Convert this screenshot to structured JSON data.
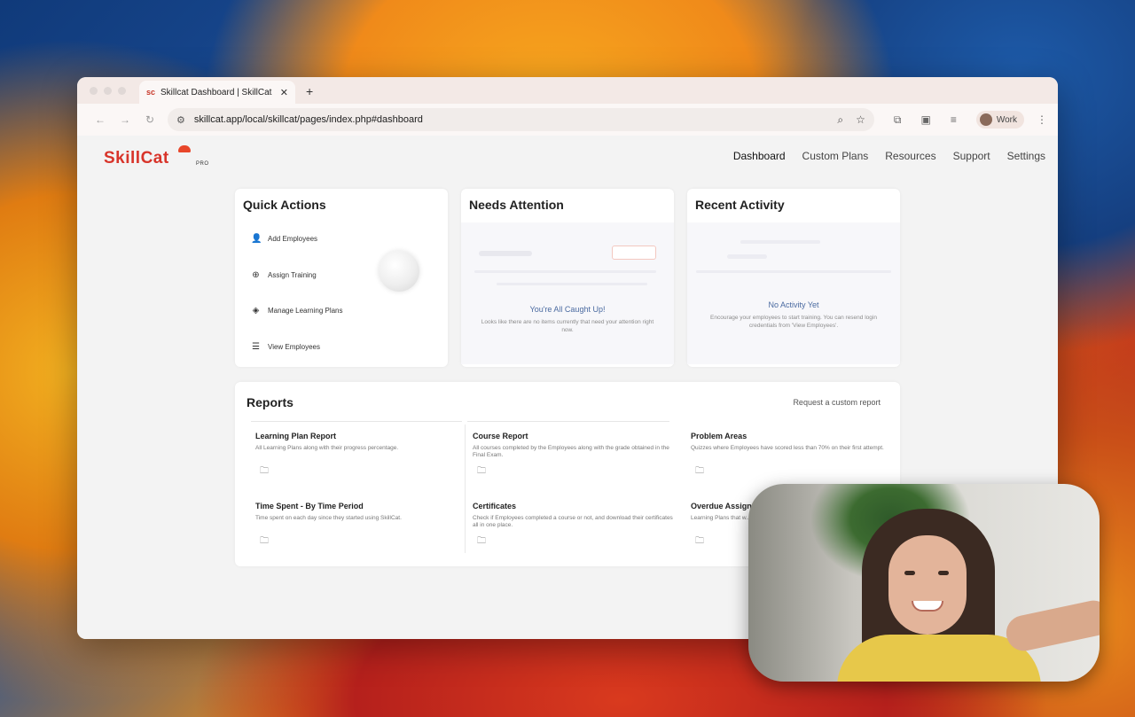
{
  "browser": {
    "tab_title": "Skillcat Dashboard | SkillCat",
    "tab_favicon": "sc",
    "url": "skillcat.app/local/skillcat/pages/index.php#dashboard",
    "profile_label": "Work"
  },
  "brand": {
    "logo_text": "SkillCat",
    "logo_suffix": "PRO",
    "color": "#d8342a"
  },
  "nav": {
    "items": [
      "Dashboard",
      "Custom Plans",
      "Resources",
      "Support",
      "Settings"
    ],
    "active": "Dashboard"
  },
  "quick_actions": {
    "title": "Quick Actions",
    "items": [
      {
        "label": "Add Employees",
        "icon": "add-user-icon"
      },
      {
        "label": "Assign Training",
        "icon": "plus-circle-icon"
      },
      {
        "label": "Manage Learning Plans",
        "icon": "tag-icon"
      },
      {
        "label": "View Employees",
        "icon": "list-icon"
      }
    ]
  },
  "needs_attention": {
    "title": "Needs Attention",
    "empty_title": "You're All Caught Up!",
    "empty_text": "Looks like there are no items currently that need your attention right now."
  },
  "recent_activity": {
    "title": "Recent Activity",
    "empty_title": "No Activity Yet",
    "empty_text": "Encourage your employees to start training. You can resend login credentials from 'View Employees'."
  },
  "reports": {
    "title": "Reports",
    "request_link": "Request a custom report",
    "items": [
      {
        "title": "Learning Plan Report",
        "desc": "All Learning Plans along with their progress percentage."
      },
      {
        "title": "Course Report",
        "desc": "All courses completed by the Employees along with the grade obtained in the Final Exam."
      },
      {
        "title": "Problem Areas",
        "desc": "Quizzes where Employees have scored less than 70% on their first attempt."
      },
      {
        "title": "Time Spent - By Time Period",
        "desc": "Time spent on each day since they started using SkillCat."
      },
      {
        "title": "Certificates",
        "desc": "Check if Employees completed a course or not, and download their certificates all in one place."
      },
      {
        "title": "Overdue Assignm",
        "desc": "Learning Plans that w... the due date."
      }
    ]
  }
}
